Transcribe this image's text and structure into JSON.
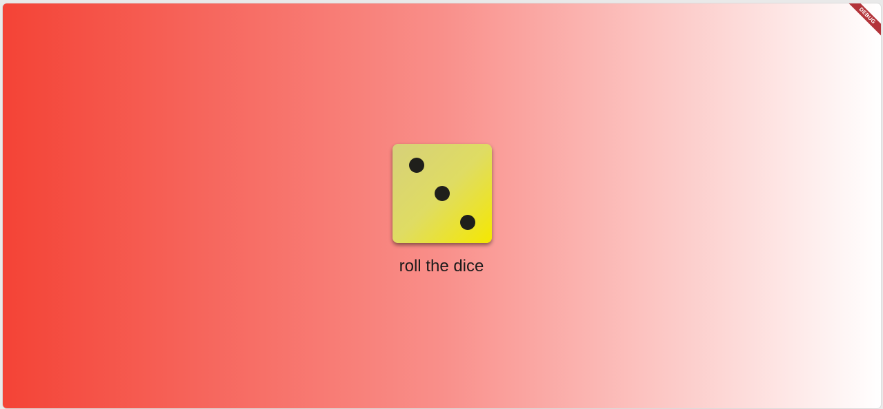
{
  "app": {
    "debug_banner": "DEBUG",
    "gradient": [
      "#f44336",
      "#ffffff"
    ]
  },
  "dice": {
    "value": 3,
    "face_colors": [
      "#d6d07a",
      "#f5e800"
    ],
    "pip_color": "#1f1f1b"
  },
  "roll": {
    "label": "roll the dice"
  }
}
